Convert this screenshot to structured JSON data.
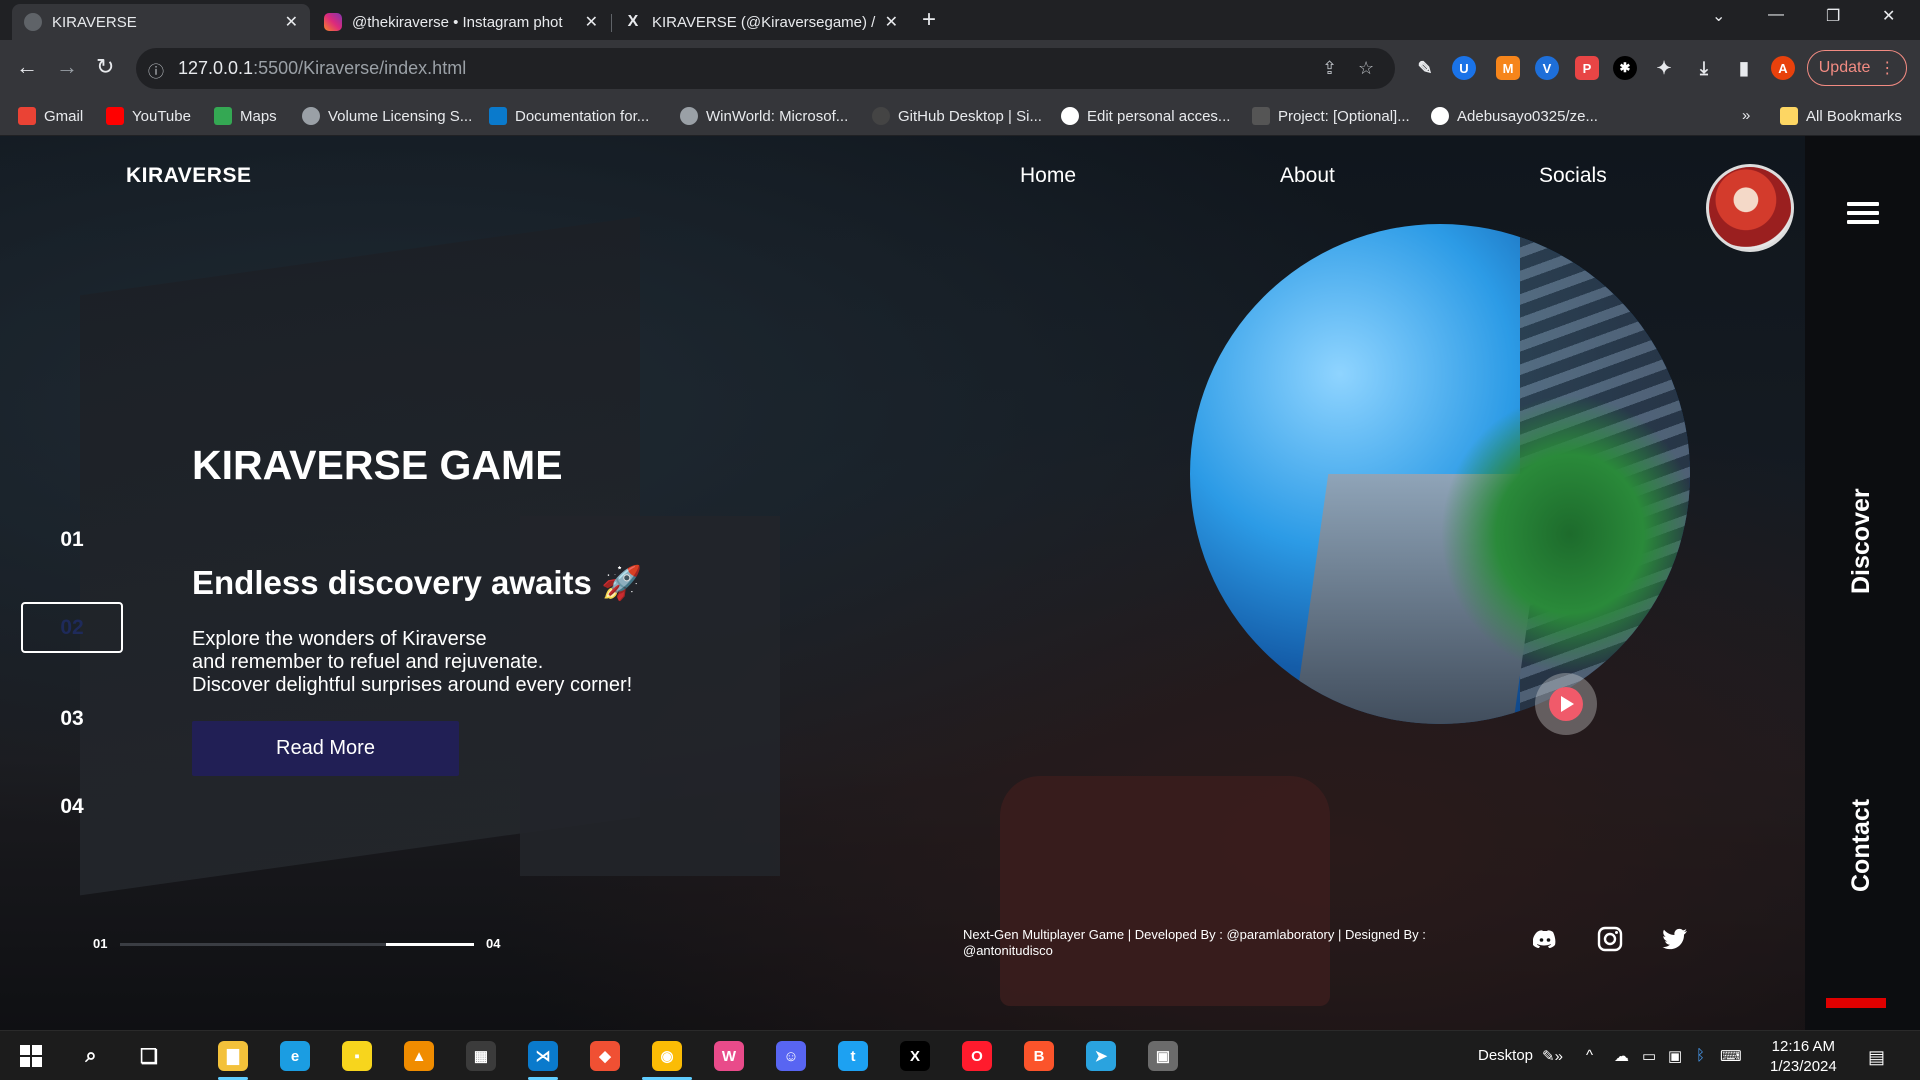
{
  "browser": {
    "tabs": [
      {
        "title": "KIRAVERSE",
        "active": true,
        "favicon_color": "#ffffff"
      },
      {
        "title": "@thekiraverse • Instagram phot",
        "active": false,
        "favicon_color": "#e1306c"
      },
      {
        "title": "KIRAVERSE (@Kiraversegame) / X",
        "active": false,
        "favicon_color": "#000000"
      }
    ],
    "new_tab_icon": "plus-icon",
    "url_host": "127.0.0.1",
    "url_path": ":5500/Kiraverse/index.html",
    "update_label": "Update",
    "profile_initial": "A",
    "bookmarks": [
      {
        "label": "Gmail",
        "icon": "gmail-icon",
        "color": "#ea4335"
      },
      {
        "label": "YouTube",
        "icon": "youtube-icon",
        "color": "#ff0000"
      },
      {
        "label": "Maps",
        "icon": "maps-icon",
        "color": "#34a853"
      },
      {
        "label": "Volume Licensing S...",
        "icon": "globe-icon",
        "color": "#9aa0a6"
      },
      {
        "label": "Documentation for...",
        "icon": "vscode-icon",
        "color": "#0a7acc"
      },
      {
        "label": "WinWorld: Microsof...",
        "icon": "globe-icon",
        "color": "#9aa0a6"
      },
      {
        "label": "GitHub Desktop | Si...",
        "icon": "github-icon",
        "color": "#6e5494"
      },
      {
        "label": "Edit personal acces...",
        "icon": "github-icon",
        "color": "#ffffff"
      },
      {
        "label": "Project: [Optional]...",
        "icon": "alx-icon",
        "color": "#555555"
      },
      {
        "label": "Adebusayo0325/ze...",
        "icon": "github-icon",
        "color": "#ffffff"
      }
    ],
    "all_bookmarks_label": "All Bookmarks"
  },
  "site": {
    "logo": "KIRAVERSE",
    "nav": [
      "Home",
      "About",
      "Socials"
    ],
    "hero_title": "KIRAVERSE GAME",
    "hero_subtitle": "Endless discovery awaits 🚀",
    "hero_desc": [
      "Explore the wonders of Kiraverse",
      "and remember to refuel and rejuvenate.",
      "Discover delightful surprises around every corner!"
    ],
    "read_more_label": "Read More",
    "slides": [
      "01",
      "02",
      "03",
      "04"
    ],
    "active_slide": "02",
    "progress_start": "01",
    "progress_end": "04",
    "progress_fraction": 0.25,
    "footer_text": "Next-Gen Multiplayer Game | Developed By : @paramlaboratory | Designed By : @antonitudisco",
    "socials": [
      "discord-icon",
      "instagram-icon",
      "twitter-icon"
    ],
    "side_labels": [
      "Discover",
      "Contact"
    ],
    "accent_color": "#211f55",
    "play_color": "#f05a6a"
  },
  "taskbar": {
    "desktop_label": "Desktop",
    "time": "12:16 AM",
    "date": "1/23/2024",
    "apps": [
      {
        "icon": "file-explorer-icon",
        "color": "#f3c13a"
      },
      {
        "icon": "edge-icon",
        "color": "#1b9de2"
      },
      {
        "icon": "sticky-notes-icon",
        "color": "#f7d51d"
      },
      {
        "icon": "vlc-icon",
        "color": "#f08c00"
      },
      {
        "icon": "calculator-icon",
        "color": "#3b3b3b"
      },
      {
        "icon": "vscode-icon",
        "color": "#0a7acc"
      },
      {
        "icon": "git-icon",
        "color": "#f05033"
      },
      {
        "icon": "chrome-icon",
        "color": "#fbbc05"
      },
      {
        "icon": "wps-icon",
        "color": "#e94b8a"
      },
      {
        "icon": "discord-icon",
        "color": "#5865f2"
      },
      {
        "icon": "twitter-icon",
        "color": "#1da1f2"
      },
      {
        "icon": "x-icon",
        "color": "#000000"
      },
      {
        "icon": "opera-icon",
        "color": "#ff1b2d"
      },
      {
        "icon": "brave-icon",
        "color": "#fb542b"
      },
      {
        "icon": "telegram-icon",
        "color": "#2aa3df"
      },
      {
        "icon": "photos-icon",
        "color": "#6b6b6b"
      }
    ]
  }
}
